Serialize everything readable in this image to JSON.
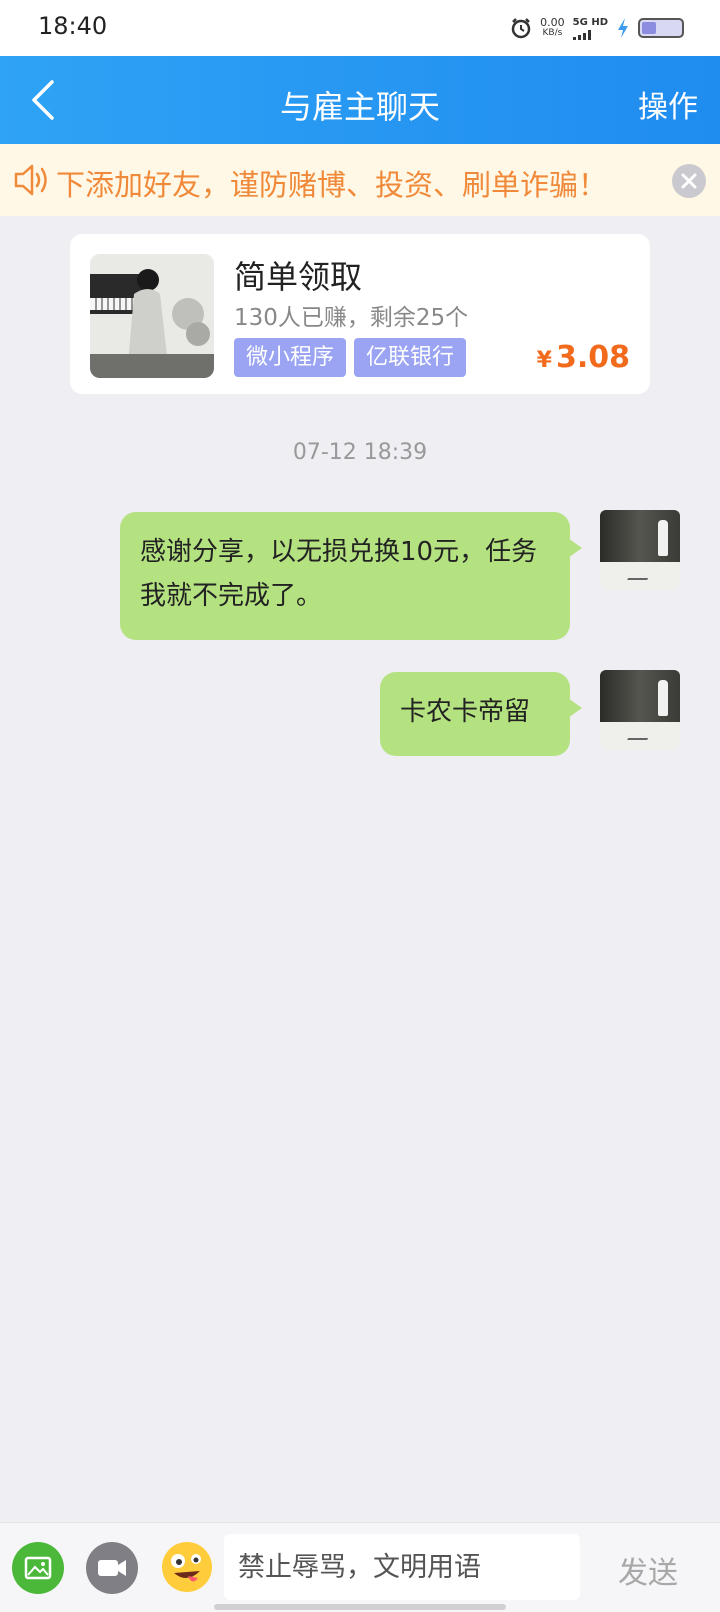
{
  "status_bar": {
    "time": "18:40",
    "net_speed": "0.00",
    "net_unit": "KB/s",
    "network": "5G HD"
  },
  "header": {
    "title": "与雇主聊天",
    "action": "操作",
    "color": "#2196f3"
  },
  "notice": {
    "text": "下添加好友，谨防赌博、投资、刷单诈骗！",
    "color": "#f08a3a"
  },
  "task": {
    "title": "简单领取",
    "stats": "130人已赚，剩余25个",
    "tags": [
      "微小程序",
      "亿联银行"
    ],
    "currency": "¥",
    "price": "3.08"
  },
  "chat": {
    "timestamp": "07-12 18:39",
    "messages": [
      {
        "text": "感谢分享，以无损兑换10元，任务我就不完成了。"
      },
      {
        "text": "卡农卡帝留"
      }
    ],
    "bubble_color": "#b4e281"
  },
  "input": {
    "placeholder": "禁止辱骂，文明用语",
    "send_label": "发送"
  }
}
